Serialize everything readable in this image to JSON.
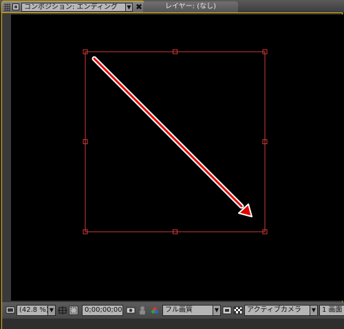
{
  "tabs": {
    "active_label": "コンポジション: エンディング",
    "active_dropdown_glyph": "▼",
    "close_glyph": "✖",
    "inactive_label": "レイヤー: (なし)"
  },
  "toolbar": {
    "zoom": "(42.8 %)",
    "timecode": "0;00;00;00",
    "resolution": "フル画質",
    "camera": "アクティブカメラ",
    "views": "1 画面",
    "dropdown_glyph": "▼"
  },
  "colors": {
    "panel_border": "#e7b100",
    "bounding_box": "#d23a3a",
    "arrow": "#e00000"
  },
  "icons": [
    "grip-icon",
    "composition-icon",
    "close-icon",
    "monitor-icon",
    "safe-zones-icon",
    "region-icon",
    "snapshot-icon",
    "show-snapshot-icon",
    "channel-icon",
    "fast-preview-icon",
    "transparency-grid-icon"
  ]
}
